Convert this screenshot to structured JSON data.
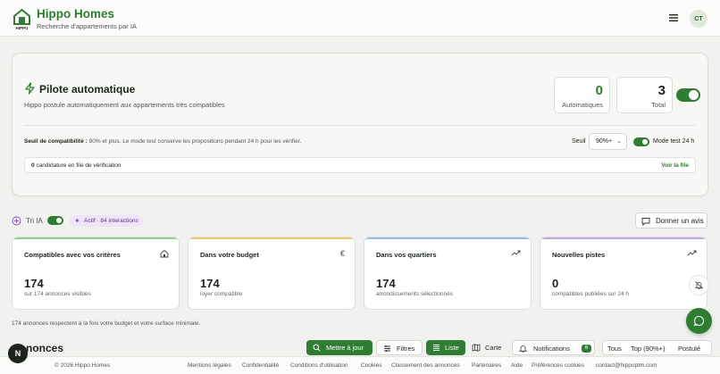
{
  "header": {
    "logo_text": "HIPPO",
    "title": "Hippo Homes",
    "subtitle": "Recherche d'appartements par IA",
    "avatar_initials": "CT"
  },
  "autopilot": {
    "title": "Pilote automatique",
    "description": "Hippo postule automatiquement aux appartements très compatibles",
    "stats": [
      {
        "value": "0",
        "label": "Automatiques",
        "color": "#2f7d32"
      },
      {
        "value": "3",
        "label": "Total",
        "color": "#1c241c"
      }
    ],
    "enabled": true,
    "threshold_label": "Seuil de compatibilité :",
    "threshold_text": "90% et plus. Le mode test conserve les propositions pendant 24 h pour les vérifier.",
    "seuil_label": "Seuil",
    "seuil_value": "90%+",
    "test_mode_label": "Mode test 24 h",
    "test_mode_enabled": true,
    "queue_count": "0",
    "queue_text": "candidature en file de vérification",
    "queue_link": "Voir la file"
  },
  "tri": {
    "label": "Tri IA",
    "enabled": true,
    "badge": "Actif · 84 interactions",
    "feedback_button": "Donner un avis"
  },
  "cards": [
    {
      "title": "Compatibles avec vos critères",
      "icon": "home-icon",
      "value": "174",
      "sub": "sur 174 annonces visibles",
      "accent": "#8fd08f"
    },
    {
      "title": "Dans votre budget",
      "icon": "euro-icon",
      "value": "174",
      "sub": "loyer compatible",
      "accent": "#e8c76a"
    },
    {
      "title": "Dans vos quartiers",
      "icon": "trend-icon",
      "value": "174",
      "sub": "arrondissements sélectionnés",
      "accent": "#9fb6e6"
    },
    {
      "title": "Nouvelles pistes",
      "icon": "trend-icon",
      "value": "0",
      "sub": "compatibles publiées sur 24 h",
      "accent": "#c9a7e6"
    }
  ],
  "summary": "174 annonces respectent à la fois votre budget et votre surface minimale.",
  "listings": {
    "section_title": "Annonces",
    "refresh_button": "Mettre à jour",
    "filters_button": "Filtres",
    "list_button": "Liste",
    "map_button": "Carte",
    "notifications_button": "Notifications",
    "notifications_count": "6",
    "tab_all": "Tous",
    "tab_top": "Top (90%+)",
    "tab_applied": "Postulé"
  },
  "footer": {
    "copyright": "© 2026 Hippo Homes",
    "links": [
      "Mentions légales",
      "Confidentialité",
      "Conditions d'utilisation",
      "Cookies",
      "Classement des annonces",
      "Partenaires",
      "Aide",
      "Préférences cookies",
      "contact@hippoptm.com"
    ]
  },
  "fab_label": "N",
  "colors": {
    "brand": "#2f7d32",
    "background": "#f1f2ef"
  }
}
